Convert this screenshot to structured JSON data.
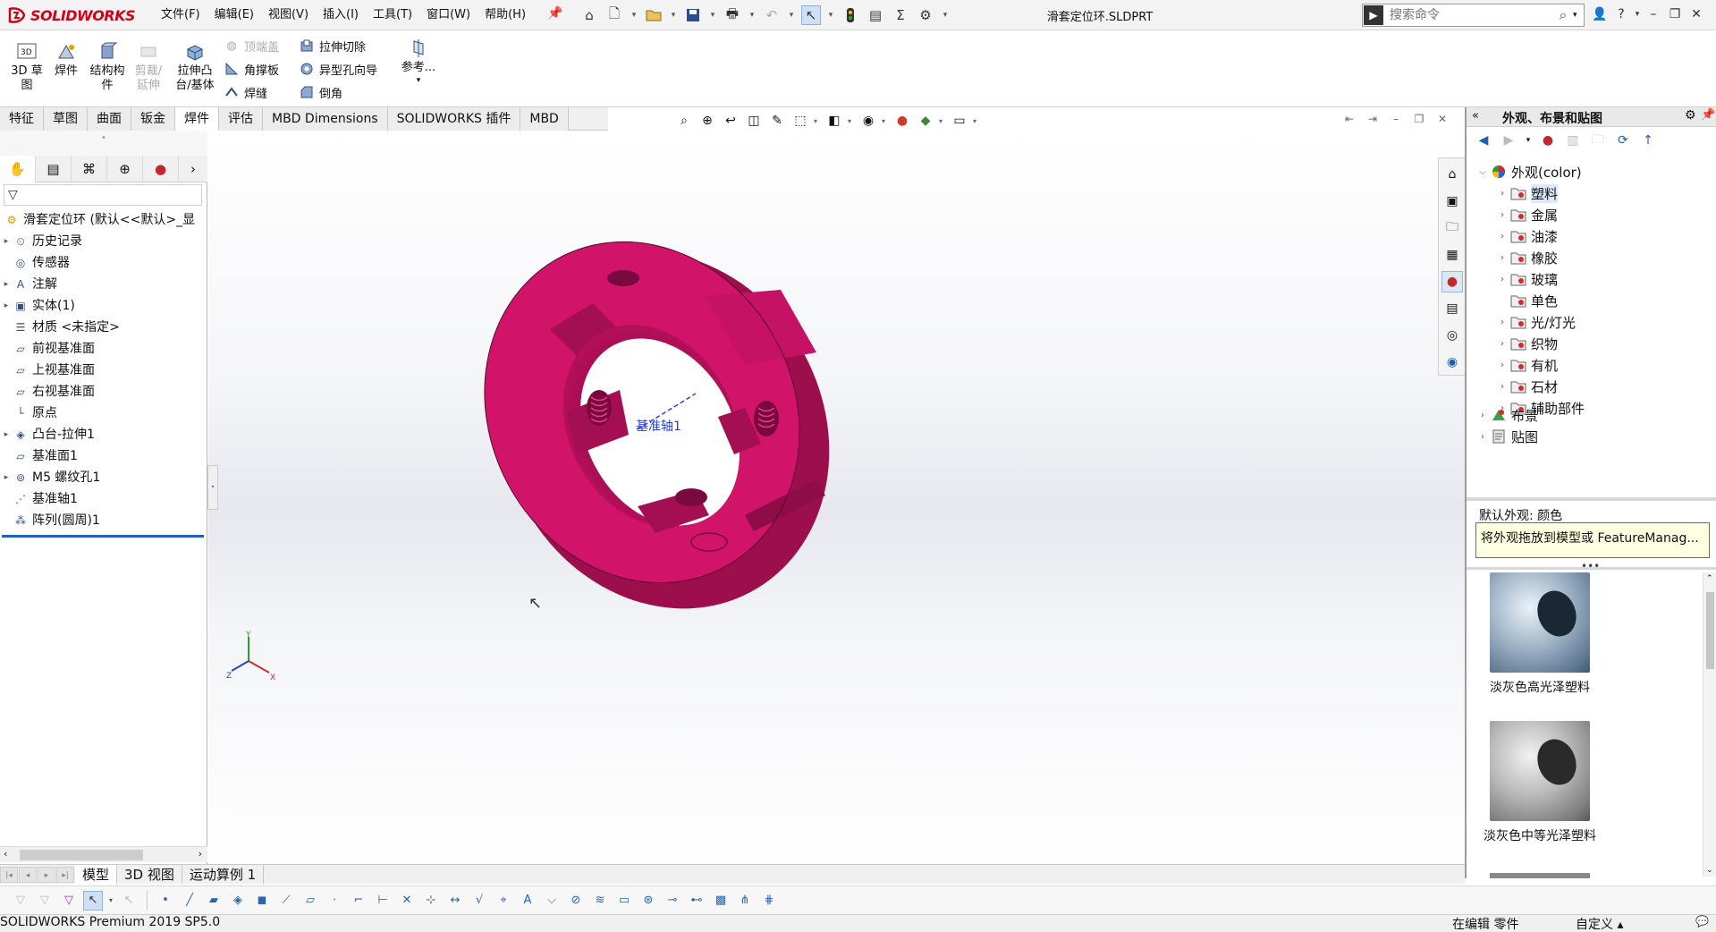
{
  "app": {
    "logo_text": "SOLIDWORKS",
    "doc_title": "滑套定位环.SLDPRT",
    "search_placeholder": "搜索命令",
    "menu": [
      "文件(F)",
      "编辑(E)",
      "视图(V)",
      "插入(I)",
      "工具(T)",
      "窗口(W)",
      "帮助(H)"
    ]
  },
  "command_manager": {
    "big_buttons": [
      {
        "id": "sketch3d",
        "label": "3D 草\n图",
        "disabled": false
      },
      {
        "id": "weldment",
        "label": "焊件",
        "disabled": false
      },
      {
        "id": "structural",
        "label": "结构构\n件",
        "disabled": false
      },
      {
        "id": "trim",
        "label": "剪裁/\n延伸",
        "disabled": true
      },
      {
        "id": "boss",
        "label": "拉伸凸\n台/基体",
        "disabled": false
      }
    ],
    "small_buttons": [
      {
        "id": "endcap",
        "label": "顶端盖",
        "disabled": true
      },
      {
        "id": "gusset",
        "label": "角撑板",
        "disabled": false
      },
      {
        "id": "weldbead",
        "label": "焊缝",
        "disabled": false
      },
      {
        "id": "cutextrude",
        "label": "拉伸切除",
        "disabled": false
      },
      {
        "id": "holewizard",
        "label": "异型孔向导",
        "disabled": false
      },
      {
        "id": "chamfer",
        "label": "倒角",
        "disabled": false
      },
      {
        "id": "reference",
        "label": "参考...",
        "disabled": false
      }
    ],
    "tabs": [
      "特征",
      "草图",
      "曲面",
      "钣金",
      "焊件",
      "评估",
      "MBD Dimensions",
      "SOLIDWORKS 插件",
      "MBD"
    ],
    "active_tab": "焊件"
  },
  "feature_tree": {
    "root": "滑套定位环 (默认<<默认>_显",
    "items": [
      {
        "label": "历史记录",
        "expandable": true,
        "icon": "history-icon"
      },
      {
        "label": "传感器",
        "expandable": false,
        "icon": "sensor-icon"
      },
      {
        "label": "注解",
        "expandable": true,
        "icon": "annotation-icon"
      },
      {
        "label": "实体(1)",
        "expandable": true,
        "icon": "solid-body-icon"
      },
      {
        "label": "材质 <未指定>",
        "expandable": false,
        "icon": "material-icon"
      },
      {
        "label": "前视基准面",
        "expandable": false,
        "icon": "plane-icon"
      },
      {
        "label": "上视基准面",
        "expandable": false,
        "icon": "plane-icon"
      },
      {
        "label": "右视基准面",
        "expandable": false,
        "icon": "plane-icon"
      },
      {
        "label": "原点",
        "expandable": false,
        "icon": "origin-icon"
      },
      {
        "label": "凸台-拉伸1",
        "expandable": true,
        "icon": "boss-extrude-icon"
      },
      {
        "label": "基准面1",
        "expandable": false,
        "icon": "plane-icon"
      },
      {
        "label": "M5 螺纹孔1",
        "expandable": true,
        "icon": "hole-icon"
      },
      {
        "label": "基准轴1",
        "expandable": false,
        "icon": "axis-icon"
      },
      {
        "label": "阵列(圆周)1",
        "expandable": false,
        "icon": "circular-pattern-icon"
      }
    ]
  },
  "viewport": {
    "axis_label": "基准轴1",
    "model_color": "#d1136a"
  },
  "bottom_tabs": [
    "模型",
    "3D 视图",
    "运动算例 1"
  ],
  "active_bottom_tab": "模型",
  "status": {
    "product": "SOLIDWORKS Premium 2019 SP5.0",
    "editing": "在编辑 零件",
    "custom": "自定义",
    "custom_arrow": "▴"
  },
  "task_pane": {
    "title": "外观、布景和贴图",
    "appearances_root": "外观(color)",
    "appearance_items": [
      "塑料",
      "金属",
      "油漆",
      "橡胶",
      "玻璃",
      "单色",
      "光/灯光",
      "织物",
      "有机",
      "石材",
      "辅助部件"
    ],
    "scenes": "布景",
    "decals": "贴图",
    "default_appearance": "默认外观: 颜色",
    "tooltip": "将外观拖放到模型或 FeatureManag...",
    "swatches": [
      "淡灰色高光泽塑料",
      "淡灰色中等光泽塑料"
    ]
  }
}
